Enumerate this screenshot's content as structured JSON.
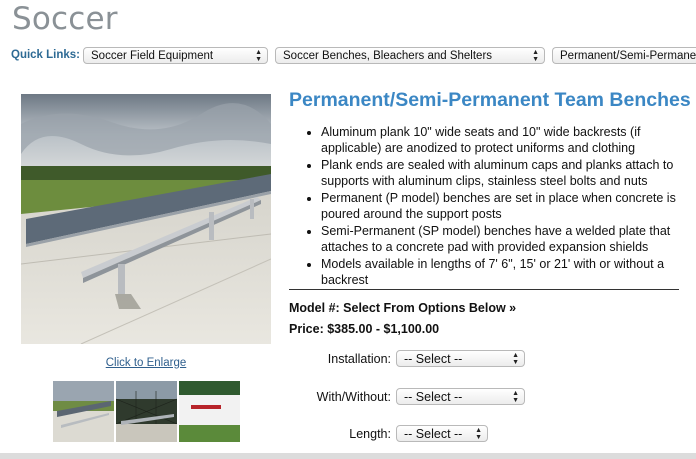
{
  "page": {
    "title": "Soccer"
  },
  "quick_links": {
    "label": "Quick Links:",
    "selects": [
      {
        "value": "Soccer Field Equipment"
      },
      {
        "value": "Soccer Benches, Bleachers and Shelters"
      },
      {
        "value": "Permanent/Semi-Permanent Team Benches"
      }
    ]
  },
  "gallery": {
    "enlarge_link": "Click to Enlarge",
    "main_image_icon": "bench-photo",
    "thumbnails": [
      "bench-side-photo",
      "bench-fence-photo",
      "bench-logo-photo"
    ]
  },
  "product": {
    "heading": "Permanent/Semi-Permanent Team Benches",
    "features": [
      "Aluminum plank 10\" wide seats and 10\" wide backrests (if applicable) are anodized to protect uniforms and clothing",
      "Plank ends are sealed with aluminum caps and planks attach to supports with aluminum clips, stainless steel bolts and nuts",
      "Permanent (P model) benches are set in place when concrete is poured around the support posts",
      "Semi-Permanent (SP model) benches have a welded plate that attaches to a concrete pad with provided expansion shields",
      "Models available in lengths of 7' 6\", 15' or 21' with or without a backrest"
    ],
    "model_line": "Model #: Select From Options Below »",
    "price_line": "Price: $385.00 - $1,100.00",
    "options": [
      {
        "label": "Installation:",
        "value": "-- Select --"
      },
      {
        "label": "With/Without:",
        "value": "-- Select --"
      },
      {
        "label": "Length:",
        "value": "-- Select --"
      }
    ]
  },
  "colors": {
    "heading": "#3b87c4",
    "title": "#8a9196",
    "link": "#2f5f8d",
    "quick_links_label": "#2d6a94"
  }
}
